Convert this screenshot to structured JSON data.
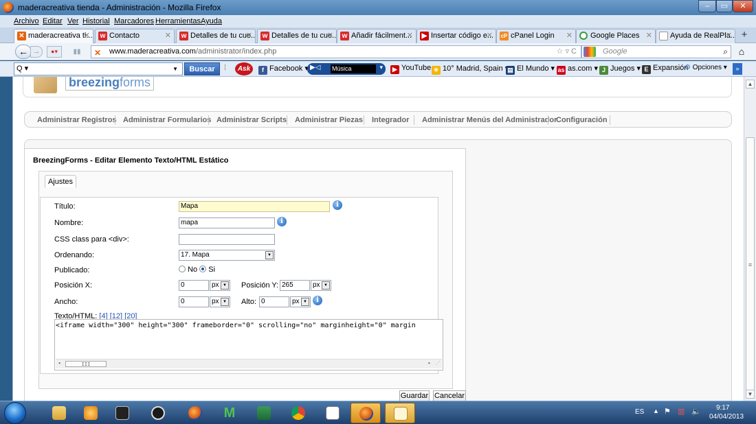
{
  "window": {
    "title": "maderacreativa tienda - Administración - Mozilla Firefox"
  },
  "menu": [
    "Archivo",
    "Editar",
    "Ver",
    "Historial",
    "Marcadores",
    "Herramientas",
    "Ayuda"
  ],
  "tabs": [
    {
      "label": "maderacreativa ti...",
      "active": true,
      "icon": "joomla-icon",
      "color": "#e8610e"
    },
    {
      "label": "Contacto",
      "icon": "w-icon",
      "color": "#d82a2a"
    },
    {
      "label": "Detalles de tu cue...",
      "icon": "w-icon",
      "color": "#d82a2a"
    },
    {
      "label": "Detalles de tu cue...",
      "icon": "w-icon",
      "color": "#d82a2a"
    },
    {
      "label": "Añadir fácilment...",
      "icon": "w-icon",
      "color": "#d82a2a"
    },
    {
      "label": "Insertar código e...",
      "icon": "youtube-icon",
      "color": "#cc0000"
    },
    {
      "label": "cPanel Login",
      "icon": "cpanel-icon",
      "color": "#f08a24"
    },
    {
      "label": "Google Places",
      "icon": "google-places-icon",
      "color": "#3a9a3a"
    },
    {
      "label": "Ayuda de RealPla...",
      "icon": "page-icon",
      "color": "#888888"
    }
  ],
  "nav": {
    "url_domain": "www.maderacreativa.com",
    "url_path": "/administrator/index.php",
    "search_placeholder": "Google"
  },
  "toolbar": {
    "search_value": "",
    "search_button": "Buscar",
    "items": [
      "Facebook ▾",
      "Música",
      "YouTube",
      "10° Madrid, Spain ▾",
      "El Mundo ▾",
      "as.com ▾",
      "Juegos ▾",
      "Expansión",
      "Opciones ▾"
    ]
  },
  "page": {
    "logo": {
      "bold": "breezing",
      "light": "forms"
    },
    "admin_nav": [
      "Administrar Registros",
      "Administrar Formularios",
      "Administrar Scripts",
      "Administrar Piezas",
      "Integrador",
      "Administrar Menús del Administrador",
      "Configuración"
    ],
    "panel_title": "BreezingForms - Editar Elemento Texto/HTML Estático",
    "tab_label": "Ajustes",
    "form": {
      "titulo_label": "Título:",
      "titulo_value": "Mapa",
      "nombre_label": "Nombre:",
      "nombre_value": "mapa",
      "css_label": "CSS class para <div>:",
      "css_value": "",
      "ordenando_label": "Ordenando:",
      "ordenando_value": "17. Mapa",
      "publicado_label": "Publicado:",
      "no_label": "No",
      "si_label": "Si",
      "posx_label": "Posición X:",
      "posx_value": "0",
      "posx_unit": "px",
      "posy_label": "Posición Y:",
      "posy_value": "265",
      "posy_unit": "px",
      "ancho_label": "Ancho:",
      "ancho_value": "0",
      "ancho_unit": "px",
      "alto_label": "Alto:",
      "alto_value": "0",
      "alto_unit": "px",
      "texto_label": "Texto/HTML:",
      "links": [
        "[4]",
        "[12]",
        "[20]"
      ],
      "code": "<iframe width=\"300\" height=\"300\" frameborder=\"0\" scrolling=\"no\" marginheight=\"0\" margin"
    },
    "buttons": {
      "save": "Guardar",
      "cancel": "Cancelar"
    }
  },
  "taskbar": {
    "lang": "ES",
    "time": "9:17",
    "date": "04/04/2013"
  }
}
